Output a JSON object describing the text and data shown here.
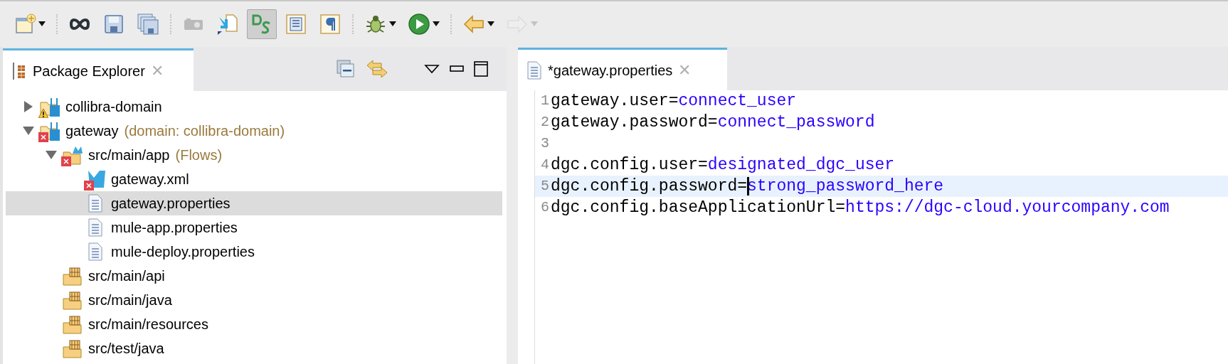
{
  "toolbar": [
    {
      "kind": "new",
      "dropdown": true,
      "selected": false,
      "disabled": false
    },
    {
      "kind": "mule",
      "dropdown": false,
      "selected": false,
      "disabled": false
    },
    {
      "kind": "save",
      "dropdown": false,
      "selected": false,
      "disabled": false
    },
    {
      "kind": "saveall",
      "dropdown": false,
      "selected": false,
      "disabled": false
    },
    {
      "kind": "camera",
      "dropdown": false,
      "selected": false,
      "disabled": true
    },
    {
      "kind": "import",
      "dropdown": false,
      "selected": false,
      "disabled": false
    },
    {
      "kind": "ds",
      "dropdown": false,
      "selected": true,
      "disabled": false
    },
    {
      "kind": "list",
      "dropdown": false,
      "selected": false,
      "disabled": false
    },
    {
      "kind": "pilcrow",
      "dropdown": false,
      "selected": false,
      "disabled": false
    },
    {
      "kind": "debug",
      "dropdown": true,
      "selected": false,
      "disabled": false
    },
    {
      "kind": "run",
      "dropdown": true,
      "selected": false,
      "disabled": false
    },
    {
      "kind": "back",
      "dropdown": true,
      "selected": false,
      "disabled": false
    },
    {
      "kind": "forward",
      "dropdown": true,
      "selected": false,
      "disabled": true
    }
  ],
  "explorer": {
    "title": "Package Explorer",
    "close": "✕",
    "tree": [
      {
        "kind": "project",
        "label": "collibra-domain",
        "warning": true,
        "error": false,
        "expanded": false,
        "selected": false
      },
      {
        "kind": "project",
        "label": "gateway",
        "annotation": "(domain: collibra-domain)",
        "warning": false,
        "error": true,
        "expanded": true,
        "selected": false,
        "children": [
          {
            "kind": "flows",
            "label": "src/main/app",
            "annotation": "(Flows)",
            "warning": false,
            "error": true,
            "expanded": true,
            "selected": false,
            "children": [
              {
                "kind": "mule",
                "label": "gateway.xml",
                "warning": false,
                "error": true,
                "selected": false
              },
              {
                "kind": "file",
                "label": "gateway.properties",
                "warning": false,
                "error": false,
                "selected": true
              },
              {
                "kind": "file",
                "label": "mule-app.properties",
                "warning": false,
                "error": false,
                "selected": false
              },
              {
                "kind": "file",
                "label": "mule-deploy.properties",
                "warning": false,
                "error": false,
                "selected": false
              }
            ]
          },
          {
            "kind": "package",
            "label": "src/main/api",
            "warning": false,
            "error": false,
            "selected": false
          },
          {
            "kind": "package",
            "label": "src/main/java",
            "warning": false,
            "error": false,
            "selected": false
          },
          {
            "kind": "package",
            "label": "src/main/resources",
            "warning": false,
            "error": false,
            "selected": false
          },
          {
            "kind": "package",
            "label": "src/test/java",
            "warning": false,
            "error": false,
            "selected": false
          }
        ]
      }
    ]
  },
  "editor": {
    "tab": {
      "title": "*gateway.properties",
      "close": "✕"
    },
    "lines": [
      {
        "number": "1",
        "key": "gateway.user=",
        "value": "connect_user",
        "current": false,
        "cursor": false
      },
      {
        "number": "2",
        "key": "gateway.password=",
        "value": "connect_password",
        "current": false,
        "cursor": false
      },
      {
        "number": "3",
        "current": false,
        "cursor": false
      },
      {
        "number": "4",
        "key": "dgc.config.user=",
        "value": "designated_dgc_user",
        "current": false,
        "cursor": false
      },
      {
        "number": "5",
        "key": "dgc.config.password=",
        "value": "strong_password_here",
        "current": true,
        "cursor": true
      },
      {
        "number": "6",
        "key": "dgc.config.baseApplicationUrl=",
        "value": "https://dgc-cloud.yourcompany.com",
        "current": false,
        "cursor": false
      }
    ]
  }
}
